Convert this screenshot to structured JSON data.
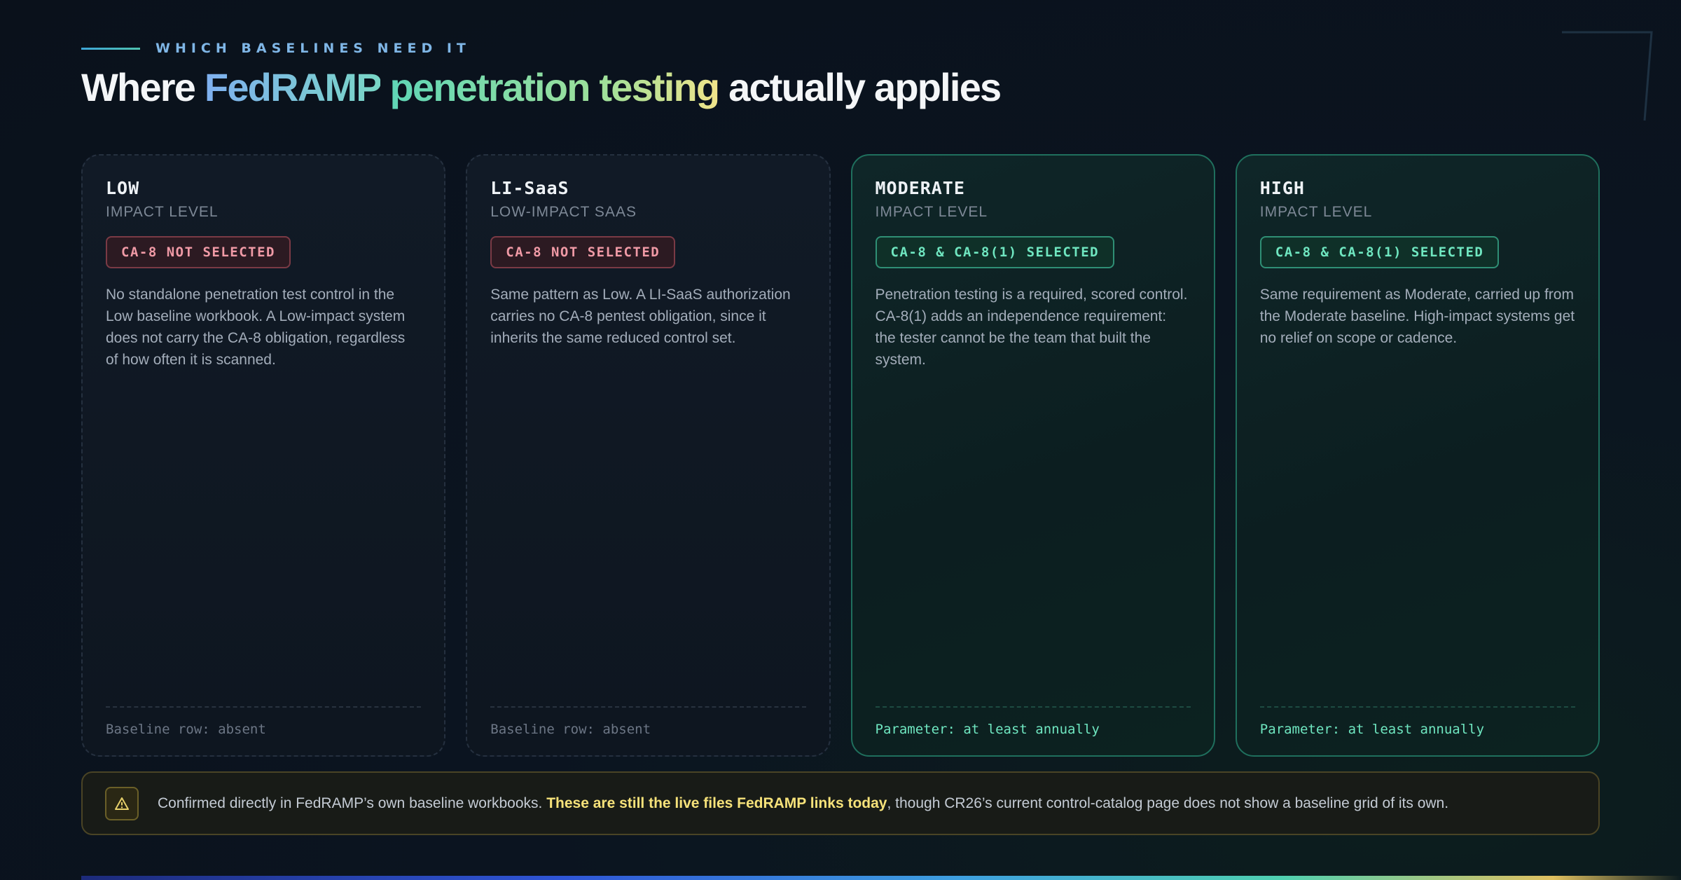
{
  "header": {
    "eyebrow": "WHICH BASELINES NEED IT",
    "title_prefix": "Where ",
    "title_highlight_a": "FedRAMP",
    "title_highlight_b": "penetration testing",
    "title_suffix": " actually applies"
  },
  "cards": [
    {
      "name": "LOW",
      "subtitle": "IMPACT LEVEL",
      "badge": "CA-8 NOT SELECTED",
      "description": "No standalone penetration test control in the Low baseline workbook. A Low-impact system does not carry the CA-8 obligation, regardless of how often it is scanned.",
      "footer": "Baseline row: absent"
    },
    {
      "name": "LI-SaaS",
      "subtitle": "LOW-IMPACT SAAS",
      "badge": "CA-8 NOT SELECTED",
      "description": "Same pattern as Low. A LI-SaaS authorization carries no CA-8 pentest obligation, since it inherits the same reduced control set.",
      "footer": "Baseline row: absent"
    },
    {
      "name": "MODERATE",
      "subtitle": "IMPACT LEVEL",
      "badge": "CA-8 & CA-8(1) SELECTED",
      "description": "Penetration testing is a required, scored control. CA-8(1) adds an independence requirement: the tester cannot be the team that built the system.",
      "footer": "Parameter: at least annually"
    },
    {
      "name": "HIGH",
      "subtitle": "IMPACT LEVEL",
      "badge": "CA-8 & CA-8(1) SELECTED",
      "description": "Same requirement as Moderate, carried up from the Moderate baseline. High-impact systems get no relief on scope or cadence.",
      "footer": "Parameter: at least annually"
    }
  ],
  "note": {
    "icon": "warning-icon",
    "text_start": "Confirmed directly in FedRAMP’s own baseline workbooks. ",
    "text_strong": "These are still the live files FedRAMP links today",
    "text_end": ", though CR26’s current control-catalog page does not show a baseline grid of its own."
  },
  "colors": {
    "background": "#0b1420",
    "accent_teal": "#6fe6c0",
    "accent_red": "#f09aa6",
    "accent_yellow": "#f6e27a",
    "accent_blue": "#7fb6e6"
  }
}
